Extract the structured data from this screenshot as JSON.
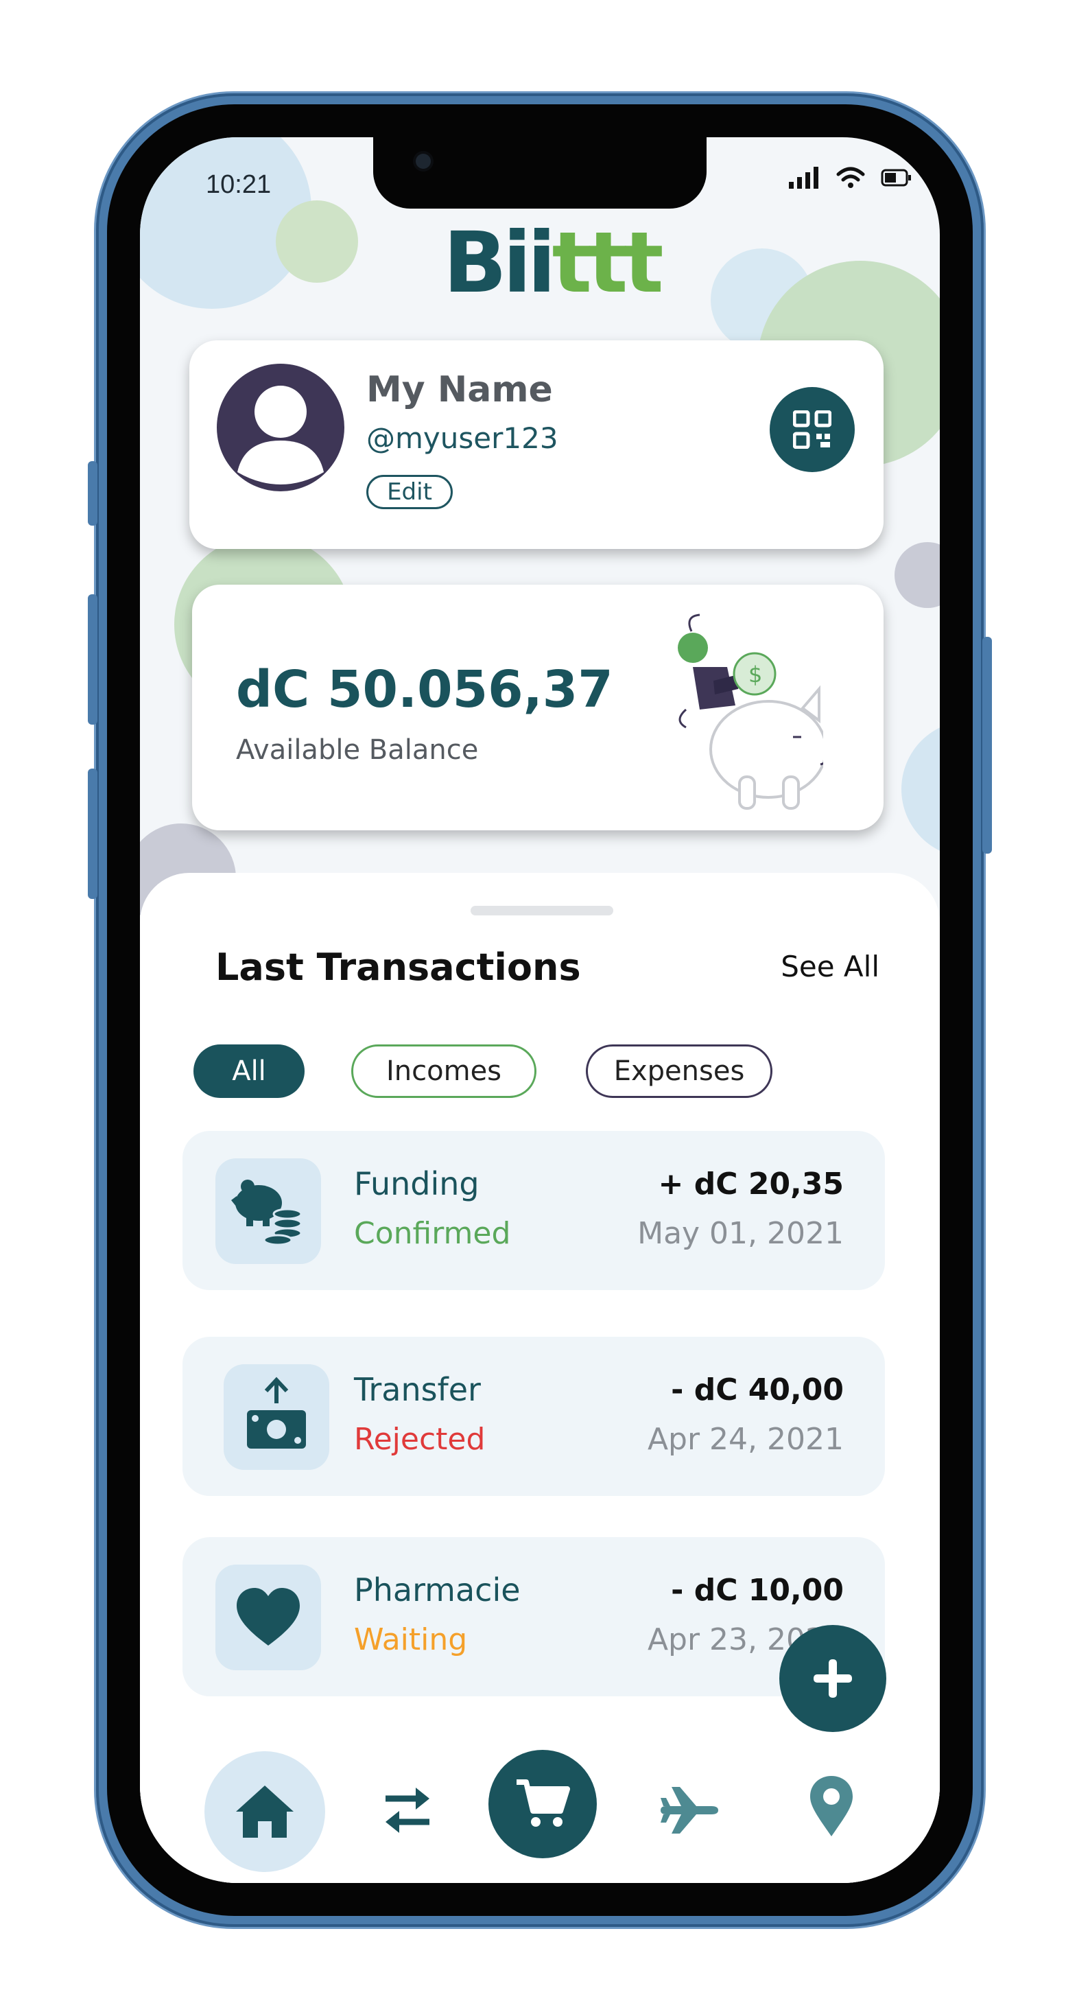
{
  "status_bar": {
    "time": "10:21"
  },
  "brand": {
    "logo_part1": "Bii",
    "logo_part2": "ttt"
  },
  "profile": {
    "name": "My Name",
    "handle": "@myuser123",
    "edit_label": "Edit",
    "qr_icon": "qr-code-icon"
  },
  "balance": {
    "amount": "dC 50.056,37",
    "label": "Available Balance"
  },
  "transactions": {
    "title": "Last Transactions",
    "see_all": "See All",
    "filters": [
      {
        "label": "All"
      },
      {
        "label": "Incomes"
      },
      {
        "label": "Expenses"
      }
    ],
    "items": [
      {
        "title": "Funding",
        "status": "Confirmed",
        "status_color": "#5aa85a",
        "amount": "+ dC 20,35",
        "date": "May 01, 2021",
        "icon": "piggy-bank-icon"
      },
      {
        "title": "Transfer",
        "status": "Rejected",
        "status_color": "#e03a3a",
        "amount": "- dC 40,00",
        "date": "Apr 24, 2021",
        "icon": "money-transfer-icon"
      },
      {
        "title": "Pharmacie",
        "status": "Waiting",
        "status_color": "#f5a02a",
        "amount": "- dC 10,00",
        "date": "Apr 23, 2021",
        "icon": "heart-icon"
      }
    ]
  },
  "nav": {
    "items": [
      "home-icon",
      "transfer-arrows-icon",
      "cart-icon",
      "airplane-icon",
      "location-pin-icon"
    ]
  },
  "colors": {
    "primary": "#1a535c",
    "accent_green": "#5aa85a",
    "rejected": "#e03a3a",
    "waiting": "#f5a02a",
    "phone_frame": "#4a7bab"
  }
}
